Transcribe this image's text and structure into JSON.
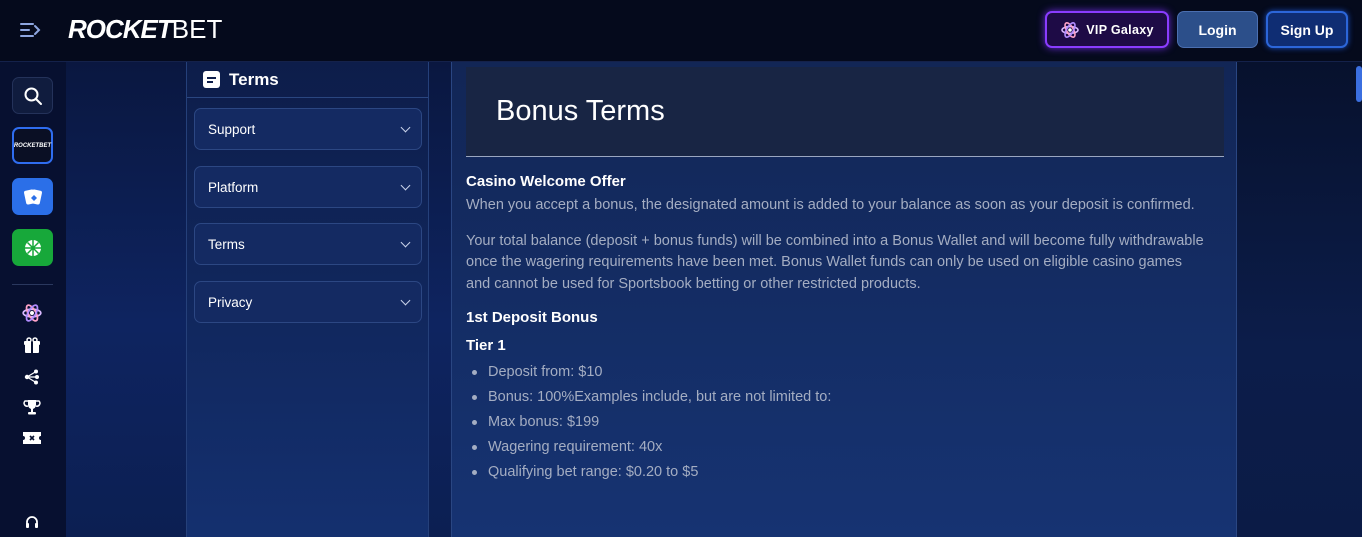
{
  "brand": {
    "logo_main": "ROCKET",
    "logo_suffix": "BET",
    "mini_logo": "ROCKETBET"
  },
  "header": {
    "vip_label": "VIP Galaxy",
    "login_label": "Login",
    "signup_label": "Sign Up"
  },
  "sidebar_rail": {
    "icons": [
      "search-icon",
      "rocketbet-logo-icon",
      "cards-icon",
      "sports-icon",
      "atom-icon",
      "gift-icon",
      "network-icon",
      "trophy-icon",
      "ticket-icon",
      "support-icon"
    ]
  },
  "side_panel": {
    "title": "Terms",
    "accordions": [
      {
        "label": "Support"
      },
      {
        "label": "Platform"
      },
      {
        "label": "Terms"
      },
      {
        "label": "Privacy"
      }
    ]
  },
  "article": {
    "title": "Bonus Terms",
    "section_title": "Casino Welcome Offer",
    "para1": "When you accept a bonus, the designated amount is added to your balance as soon as your deposit is confirmed.",
    "para2": "Your total balance (deposit + bonus funds) will be combined into a Bonus Wallet and will become fully withdrawable once the wagering requirements have been met. Bonus Wallet funds can only be used on eligible casino games and cannot be used for Sportsbook betting or other restricted products.",
    "subsection_title": "1st Deposit Bonus",
    "tier_title": "Tier 1",
    "tier_items": [
      "Deposit from: $10",
      "Bonus: 100%Examples include, but are not limited to:",
      "Max bonus: $199",
      "Wagering requirement: 40x",
      "Qualifying bet range: $0.20 to $5"
    ]
  },
  "colors": {
    "vip_border": "#8a3cff",
    "signup_border": "#2c66d9",
    "rail_cards": "#2b6fe8",
    "rail_sports": "#17a83a",
    "body_text": "#a4adc2"
  }
}
